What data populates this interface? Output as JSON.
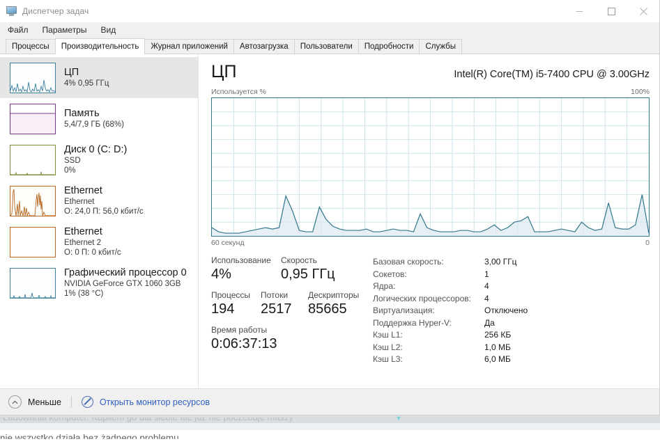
{
  "window": {
    "title": "Диспетчер задач",
    "icon": "task-manager-icon",
    "controls": {
      "minimize": "Свернуть",
      "maximize": "Развернуть",
      "close": "Закрыть"
    }
  },
  "menu": {
    "items": [
      "Файл",
      "Параметры",
      "Вид"
    ]
  },
  "tabs": {
    "active_index": 1,
    "items": [
      "Процессы",
      "Производительность",
      "Журнал приложений",
      "Автозагрузка",
      "Пользователи",
      "Подробности",
      "Службы"
    ]
  },
  "sidebar": {
    "items": [
      {
        "title": "ЦП",
        "line2": "4%  0,95 ГГц",
        "line3": "",
        "selected": true,
        "color": "#3c7f99",
        "graph": "cpu"
      },
      {
        "title": "Память",
        "line2": "5,4/7,9 ГБ (68%)",
        "line3": "",
        "selected": false,
        "color": "#7a3b86",
        "graph": "memory"
      },
      {
        "title": "Диск 0 (C: D:)",
        "line2": "SSD",
        "line3": "0%",
        "selected": false,
        "color": "#7f8b3b",
        "graph": "disk"
      },
      {
        "title": "Ethernet",
        "line2": "Ethernet",
        "line3": "О: 24,0 П: 56,0 кбит/с",
        "selected": false,
        "color": "#b5651d",
        "graph": "eth1"
      },
      {
        "title": "Ethernet",
        "line2": "Ethernet 2",
        "line3": "О: 0 П: 0 кбит/с",
        "selected": false,
        "color": "#b5651d",
        "graph": "eth2"
      },
      {
        "title": "Графический процессор 0",
        "line2": "NVIDIA GeForce GTX 1060 3GB",
        "line3": "1%  (38 °C)",
        "selected": false,
        "color": "#3c7f99",
        "graph": "gpu"
      }
    ]
  },
  "main": {
    "heading": "ЦП",
    "model": "Intel(R) Core(TM) i5-7400 CPU @ 3.00GHz",
    "graph_top_label": "Используется %",
    "graph_top_right": "100%",
    "graph_bottom_label": "60 секунд",
    "graph_bottom_right": "0",
    "graph_color": "#37798e",
    "stats": {
      "utilization_label": "Использование",
      "utilization_value": "4%",
      "speed_label": "Скорость",
      "speed_value": "0,95 ГГц",
      "processes_label": "Процессы",
      "processes_value": "194",
      "threads_label": "Потоки",
      "threads_value": "2517",
      "handles_label": "Дескрипторы",
      "handles_value": "85665",
      "uptime_label": "Время работы",
      "uptime_value": "0:06:37:13"
    },
    "info": [
      {
        "key": "Базовая скорость:",
        "value": "3,00 ГГц"
      },
      {
        "key": "Сокетов:",
        "value": "1"
      },
      {
        "key": "Ядра:",
        "value": "4"
      },
      {
        "key": "Логических процессоров:",
        "value": "4"
      },
      {
        "key": "Виртуализация:",
        "value": "Отключено"
      },
      {
        "key": "Поддержка Hyper-V:",
        "value": "Да"
      },
      {
        "key": "Кэш L1:",
        "value": "256 КБ"
      },
      {
        "key": "Кэш L2:",
        "value": "1,0 МБ"
      },
      {
        "key": "Кэш L3:",
        "value": "6,0 МБ"
      }
    ]
  },
  "footer": {
    "collapse_label": "Меньше",
    "resource_monitor_label": "Открыть монитор ресурсов",
    "link_color": "#2f5fbf"
  },
  "background": {
    "clipped_text": "Ładowania komputer. Kupiłem go dla siebie ale już nie poczebuje maszy",
    "lower_text": "nie wszystko działa bez żadnego problemu"
  },
  "chart_data": {
    "type": "area",
    "title": "ЦП — Используется %",
    "xlabel": "60 секунд",
    "ylabel": "Используется %",
    "ylim": [
      0,
      100
    ],
    "xlim": [
      0,
      60
    ],
    "grid": true,
    "legend": "none",
    "series": [
      {
        "name": "Используется %",
        "values": [
          6,
          3,
          2,
          2,
          2,
          3,
          4,
          5,
          6,
          5,
          6,
          29,
          18,
          4,
          3,
          3,
          21,
          12,
          7,
          5,
          4,
          4,
          4,
          5,
          3,
          3,
          4,
          5,
          4,
          4,
          3,
          16,
          6,
          4,
          3,
          3,
          3,
          4,
          4,
          3,
          3,
          5,
          8,
          4,
          6,
          10,
          11,
          14,
          3,
          3,
          3,
          4,
          5,
          4,
          3,
          10,
          6,
          4,
          5,
          24,
          6,
          5,
          5,
          8,
          30,
          2
        ]
      }
    ]
  }
}
